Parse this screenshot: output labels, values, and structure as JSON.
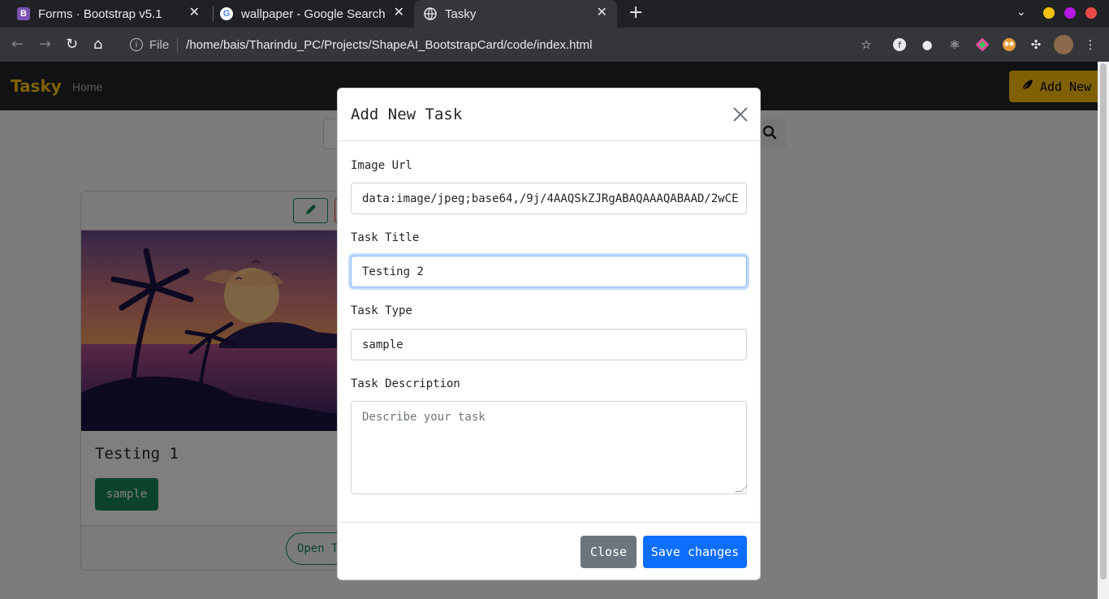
{
  "browser": {
    "tabs": [
      {
        "title": "Forms · Bootstrap v5.1",
        "favicon": "bootstrap-icon",
        "active": false
      },
      {
        "title": "wallpaper - Google Search",
        "favicon": "google-icon",
        "active": false
      },
      {
        "title": "Tasky",
        "favicon": "globe-icon",
        "active": true
      }
    ],
    "address": {
      "scheme_label": "File",
      "url": "/home/bais/Tharindu_PC/Projects/ShapeAI_BootstrapCard/code/index.html"
    },
    "window_controls": {
      "colors": [
        "#f4c20d",
        "#b517e6",
        "#ea4a4a"
      ]
    }
  },
  "app": {
    "brand": "Tasky",
    "nav_link": "Home",
    "add_new_label": "Add New",
    "accent": "#ffc107"
  },
  "card": {
    "title": "Testing 1",
    "badge": "sample",
    "open_button": "Open Task"
  },
  "modal": {
    "title": "Add New Task",
    "fields": {
      "image_url_label": "Image Url",
      "image_url_value": "data:image/jpeg;base64,/9j/4AAQSkZJRgABAQAAAQABAAD/2wCE",
      "title_label": "Task Title",
      "title_value": "Testing 2",
      "type_label": "Task Type",
      "type_value": "sample",
      "description_label": "Task Description",
      "description_placeholder": "Describe your task"
    },
    "buttons": {
      "close": "Close",
      "save": "Save changes"
    }
  }
}
